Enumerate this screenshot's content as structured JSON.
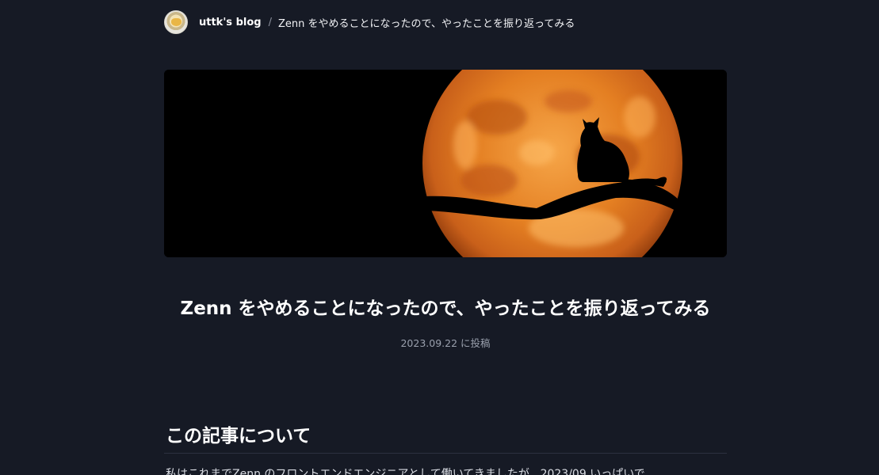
{
  "header": {
    "blog_name": "uttk's blog",
    "separator": "/",
    "breadcrumb_title": "Zenn をやめることになったので、やったことを振り返ってみる"
  },
  "article": {
    "title": "Zenn をやめることになったので、やったことを振り返ってみる",
    "posted": "2023.09.22 に投稿",
    "hero_image_alt": "cat silhouette on branch in front of full moon",
    "section_heading": "この記事について",
    "intro_partial": "私はこれまでZenn のフロントエンドエンジニアとして働いてきましたが、2023/09 いっぱいで"
  },
  "colors": {
    "background": "#161a25",
    "moon": "#e8892c",
    "text": "#ffffff",
    "muted": "#9aa0ad"
  }
}
